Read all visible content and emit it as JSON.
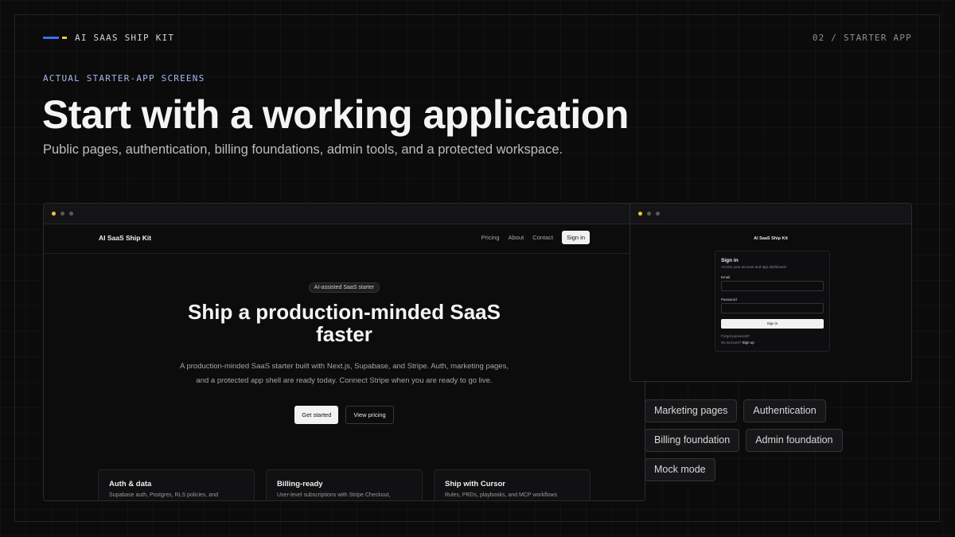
{
  "header": {
    "brand": "AI SAAS SHIP KIT",
    "page_number": "02 / STARTER APP",
    "accent_colors": {
      "blue": "#3b6ff6",
      "yellow": "#f4c542"
    }
  },
  "intro": {
    "eyebrow": "ACTUAL STARTER-APP SCREENS",
    "title": "Start with a working application",
    "subtitle": "Public pages, authentication, billing foundations, admin tools, and a protected workspace."
  },
  "main_screen": {
    "nav": {
      "logo": "AI SaaS Ship Kit",
      "links": [
        "Pricing",
        "About",
        "Contact"
      ],
      "signin": "Sign in"
    },
    "hero": {
      "pill": "AI-assisted SaaS starter",
      "title": "Ship a production-minded SaaS faster",
      "copy": "A production-minded SaaS starter built with Next.js, Supabase, and Stripe. Auth, marketing pages, and a protected app shell are ready today. Connect Stripe when you are ready to go live.",
      "primary_cta": "Get started",
      "secondary_cta": "View pricing"
    },
    "cards": [
      {
        "title": "Auth & data",
        "desc": "Supabase auth, Postgres, RLS policies, and"
      },
      {
        "title": "Billing-ready",
        "desc": "User-level subscriptions with Stripe Checkout,"
      },
      {
        "title": "Ship with Cursor",
        "desc": "Rules, PRDs, playbooks, and MCP workflows"
      }
    ]
  },
  "signin_screen": {
    "logo": "AI SaaS Ship Kit",
    "title": "Sign in",
    "subtitle": "Access your account and app dashboard.",
    "email_label": "Email",
    "password_label": "Password",
    "button": "Sign in",
    "forgot": "Forgot password?",
    "no_account": "No account?",
    "signup": "Sign up"
  },
  "tags": [
    "Marketing pages",
    "Authentication",
    "Billing foundation",
    "Admin foundation",
    "Mock mode"
  ]
}
